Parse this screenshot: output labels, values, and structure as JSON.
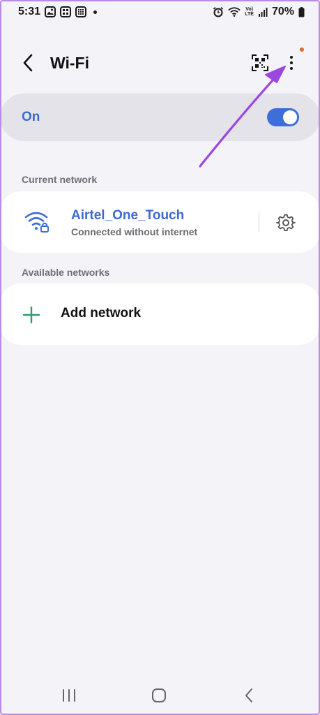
{
  "status_bar": {
    "time": "5:31",
    "volte_line1": "Vo)",
    "volte_line2": "LTE",
    "battery": "70%"
  },
  "header": {
    "title": "Wi-Fi",
    "notification_dot_color": "#e06a2c"
  },
  "wifi_toggle": {
    "label": "On",
    "enabled": true,
    "accent_color": "#3e6fd8"
  },
  "current_network": {
    "section_title": "Current network",
    "name": "Airtel_One_Touch",
    "status": "Connected without internet",
    "icon": "wifi-lock-icon"
  },
  "available_networks": {
    "section_title": "Available networks",
    "add_label": "Add network",
    "add_icon_color": "#2f9e6b"
  },
  "annotation": {
    "arrow_color": "#9b48e0"
  }
}
